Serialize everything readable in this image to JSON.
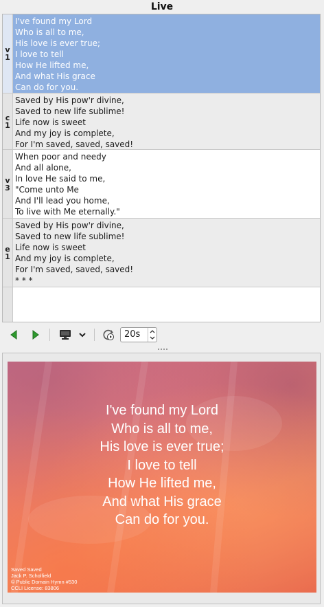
{
  "panel": {
    "title": "Live"
  },
  "slides": [
    {
      "tag": [
        "v",
        "1"
      ],
      "selected": true,
      "lines": [
        "I've found my Lord",
        "Who is all to me,",
        "His love is ever true;",
        "I love to tell",
        "How He lifted me,",
        "And what His grace",
        "Can do for you."
      ]
    },
    {
      "tag": [
        "c",
        "1"
      ],
      "selected": false,
      "lines": [
        "Saved by His pow'r divine,",
        "Saved to new life sublime!",
        "Life now is sweet",
        "And my joy is complete,",
        "For I'm saved, saved, saved!"
      ]
    },
    {
      "tag": [
        "v",
        "3"
      ],
      "selected": false,
      "lines": [
        "When poor and needy",
        "And all alone,",
        "In love He said to me,",
        "\"Come unto Me",
        "And I'll lead you home,",
        "To live with Me eternally.\""
      ]
    },
    {
      "tag": [
        "e",
        "1"
      ],
      "selected": false,
      "lines": [
        "Saved by His pow'r divine,",
        "Saved to new life sublime!",
        "Life now is sweet",
        "And my joy is complete,",
        "For I'm saved, saved, saved!",
        "* * *"
      ]
    }
  ],
  "toolbar": {
    "prev_icon": "previous-slide-icon",
    "next_icon": "next-slide-icon",
    "display_icon": "monitor-icon",
    "dropdown_icon": "chevron-down-icon",
    "loop_icon": "timed-loop-icon",
    "delay_value": "20s",
    "accent_color": "#2e9a2e"
  },
  "preview": {
    "lyrics": [
      "I've found my Lord",
      "Who is all to me,",
      "His love is ever true;",
      "I love to tell",
      "How He lifted me,",
      "And what His grace",
      "Can do for you."
    ],
    "footer": [
      "Saved Saved",
      "Jack P. Scholfield",
      "© Public Domain Hymn #530",
      "CCLI License: 83806"
    ]
  }
}
